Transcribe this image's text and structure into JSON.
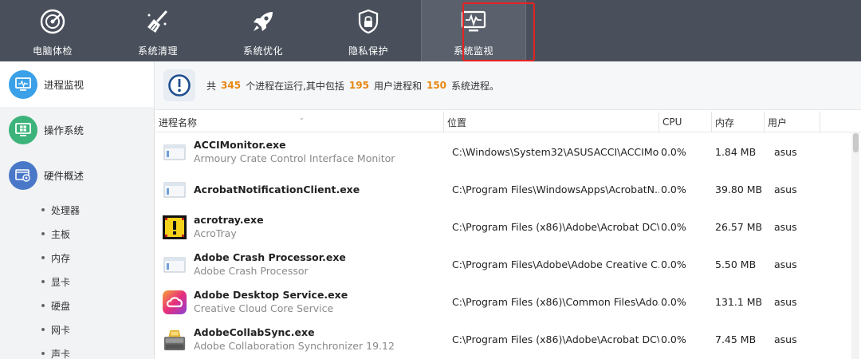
{
  "nav": {
    "items": [
      {
        "label": "电脑体检",
        "icon": "scan-target-icon"
      },
      {
        "label": "系统清理",
        "icon": "broom-icon"
      },
      {
        "label": "系统优化",
        "icon": "rocket-icon"
      },
      {
        "label": "隐私保护",
        "icon": "lock-shield-icon"
      },
      {
        "label": "系统监视",
        "icon": "monitor-pulse-icon"
      }
    ],
    "active_index": 4,
    "highlight_color": "#e52222"
  },
  "sidebar": {
    "items": [
      {
        "label": "进程监视",
        "icon": "monitor-icon",
        "color": "#3aa0e8",
        "selected": true
      },
      {
        "label": "操作系统",
        "icon": "windows-icon",
        "color": "#3cb37a",
        "selected": false
      },
      {
        "label": "硬件概述",
        "icon": "hardware-icon",
        "color": "#4a78c8",
        "selected": false
      }
    ],
    "sub_items": [
      "处理器",
      "主板",
      "内存",
      "显卡",
      "硬盘",
      "网卡",
      "声卡"
    ]
  },
  "summary": {
    "prefix": "共",
    "total": "345",
    "mid1": "个进程在运行,其中包括",
    "user": "195",
    "mid2": "用户进程和",
    "system": "150",
    "suffix": "系统进程。",
    "accent_color": "#e8870e"
  },
  "table": {
    "headers": {
      "name": "进程名称",
      "path": "位置",
      "cpu": "CPU",
      "mem": "内存",
      "user": "用户"
    },
    "rows": [
      {
        "name": "ACCIMonitor.exe",
        "desc": "Armoury Crate Control Interface Monitor",
        "path": "C:\\Windows\\System32\\ASUSACCI\\ACCIMo...",
        "cpu": "0.0%",
        "mem": "1.84 MB",
        "user": "asus",
        "icon": "window-generic-icon"
      },
      {
        "name": "AcrobatNotificationClient.exe",
        "desc": "",
        "path": "C:\\Program Files\\WindowsApps\\AcrobatN...",
        "cpu": "0.0%",
        "mem": "39.80 MB",
        "user": "asus",
        "icon": "window-generic-icon"
      },
      {
        "name": "acrotray.exe",
        "desc": "AcroTray",
        "path": "C:\\Program Files (x86)\\Adobe\\Acrobat DC\\...",
        "cpu": "0.0%",
        "mem": "26.57 MB",
        "user": "asus",
        "icon": "acrotray-warning-icon"
      },
      {
        "name": "Adobe Crash Processor.exe",
        "desc": "Adobe Crash Processor",
        "path": "C:\\Program Files\\Adobe\\Adobe Creative C...",
        "cpu": "0.0%",
        "mem": "5.50 MB",
        "user": "asus",
        "icon": "window-generic-icon"
      },
      {
        "name": "Adobe Desktop Service.exe",
        "desc": "Creative Cloud Core Service",
        "path": "C:\\Program Files (x86)\\Common Files\\Ado...",
        "cpu": "0.0%",
        "mem": "131.1 MB",
        "user": "asus",
        "icon": "creative-cloud-icon"
      },
      {
        "name": "AdobeCollabSync.exe",
        "desc": "Adobe Collaboration Synchronizer 19.12",
        "path": "C:\\Program Files (x86)\\Adobe\\Acrobat DC\\...",
        "cpu": "0.0%",
        "mem": "7.45 MB",
        "user": "asus",
        "icon": "collab-sync-icon"
      }
    ]
  }
}
